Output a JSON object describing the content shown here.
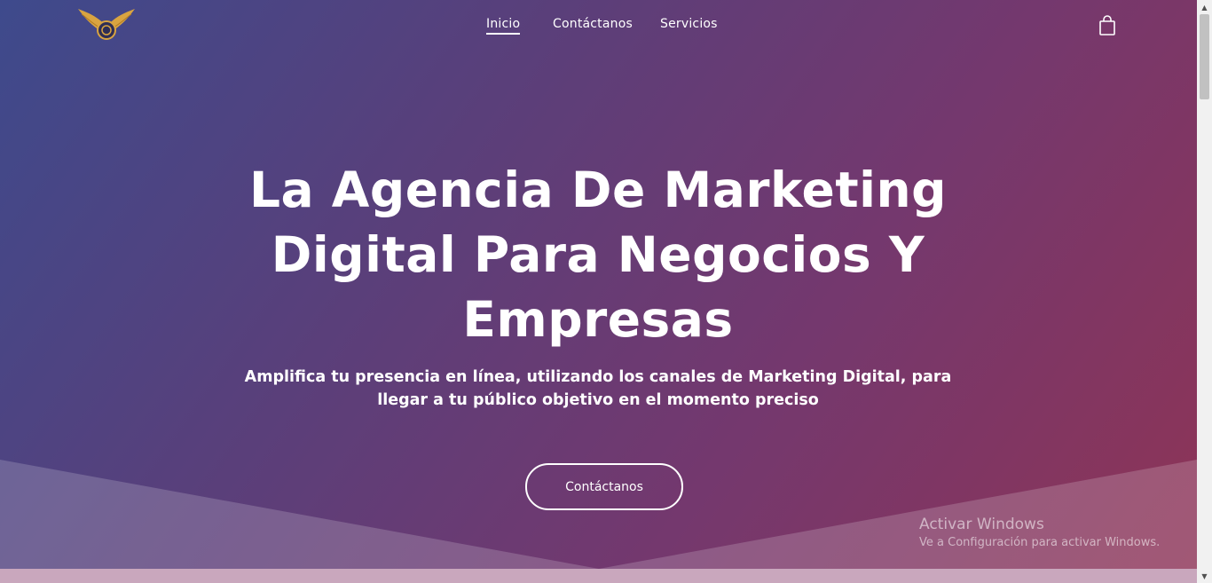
{
  "nav": {
    "items": [
      {
        "label": "Inicio",
        "active": true
      },
      {
        "label": "Contáctanos",
        "active": false
      },
      {
        "label": "Servicios",
        "active": false
      }
    ],
    "logo_icon": "winged-emblem-logo",
    "cart_icon": "shopping-bag-icon"
  },
  "hero": {
    "title": "La Agencia De Marketing Digital Para Negocios Y Empresas",
    "subtitle": "Amplifica tu presencia en línea, utilizando los canales de Marketing Digital, para llegar a tu público objetivo en el momento preciso",
    "cta_label": "Contáctanos"
  },
  "watermark": {
    "title": "Activar Windows",
    "subtitle": "Ve a Configuración para activar Windows."
  },
  "colors": {
    "gradient_start": "#3e4a8c",
    "gradient_end": "#8e3456",
    "text": "#ffffff",
    "logo_gold": "#d9a441"
  }
}
